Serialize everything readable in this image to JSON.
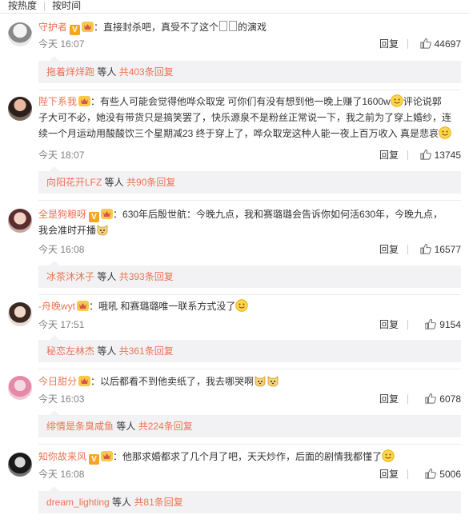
{
  "sort": {
    "by_hot": "按热度",
    "by_time": "按时间"
  },
  "comments": [
    {
      "user": "守护者",
      "text": "：直接封杀吧，真受不了这个",
      "text_tail": "的演戏",
      "time": "今天 16:07",
      "reply": "回复",
      "likes": "44697",
      "sub_user": "拖着烊烊跑",
      "sub_mid": " 等人 ",
      "sub_count": "共403条回复"
    },
    {
      "user": "陛下系我",
      "text_a": "：有些人可能会觉得他哗众取宠 可你们有没有想到他一晚上赚了1600w",
      "text_b": "评论说郭",
      "text_c": "子大可不必，她没有带货只是搞笑罢了，快乐源泉不是粉丝正常说一下，我之前为了穿上婚纱，连",
      "text_d": "续一个月运动用酸酸饮三个星期减23 终于穿上了，哗众取宠这种人能一夜上百万收入 真是悲哀",
      "time": "今天 18:07",
      "reply": "回复",
      "likes": "13745",
      "sub_user": "向阳花开LFZ",
      "sub_mid": " 等人 ",
      "sub_count": "共90条回复"
    },
    {
      "user": "全是狗粮呀",
      "text_a": "：630年后殷世航：今晚九点，我和赛璐璐会告诉你如何活630年，今晚九点，",
      "text_b": "我会准时开播",
      "time": "今天 16:08",
      "reply": "回复",
      "likes": "16577",
      "sub_user": "冰茶沐沐子",
      "sub_mid": " 等人 ",
      "sub_count": "共393条回复"
    },
    {
      "user": "-舟晚wyt",
      "text": "：哦吼 和赛璐璐唯一联系方式没了",
      "time": "今天 17:51",
      "reply": "回复",
      "likes": "9154",
      "sub_user": "秘恋左林杰",
      "sub_mid": " 等人 ",
      "sub_count": "共361条回复"
    },
    {
      "user": "今日甜分",
      "text": "：以后都看不到他卖纸了，我去哪哭啊",
      "time": "今天 16:03",
      "reply": "回复",
      "likes": "6078",
      "sub_user": "绯情是条臭咸鱼",
      "sub_mid": " 等人 ",
      "sub_count": "共224条回复"
    },
    {
      "user": "知你故来风",
      "text": "：他那求婚都求了几个月了吧，天天炒作，后面的剧情我都懂了",
      "time": "今天 16:08",
      "reply": "回复",
      "likes": "5006",
      "sub_user": "dream_lighting",
      "sub_mid": " 等人 ",
      "sub_count": "共81条回复"
    }
  ],
  "colors": {
    "username": "#eb7350",
    "meta": "#808080",
    "subbox_bg": "#f2f2f5"
  },
  "icons": [
    "verified-badge-icon",
    "vip-crown-icon",
    "thumb-up-icon",
    "emoji-icon"
  ]
}
